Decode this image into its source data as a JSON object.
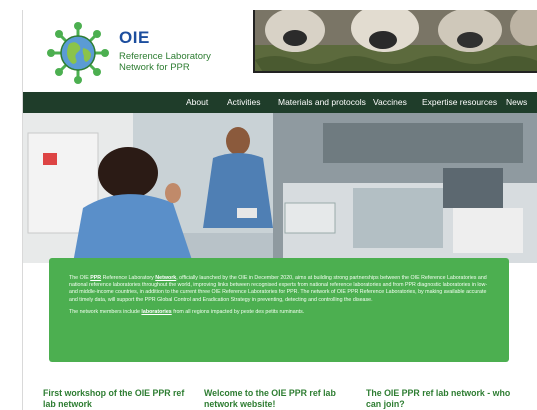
{
  "header": {
    "logo_title": "OIE",
    "logo_subtitle": "Reference Laboratory Network for PPR"
  },
  "nav": {
    "items": [
      {
        "label": "About"
      },
      {
        "label": "Activities"
      },
      {
        "label": "Materials and protocols"
      },
      {
        "label": "Vaccines"
      },
      {
        "label": "Expertise resources"
      },
      {
        "label": "News"
      }
    ]
  },
  "intro": {
    "p1_a": "The OIE ",
    "p1_link1": "PPR",
    "p1_b": " Reference Laboratory ",
    "p1_link2": "Network",
    "p1_c": ", officially launched by the OIE in December 2020, aims at building strong partnerships between the OIE Reference Laboratories and national reference laboratories throughout the world, improving links between recognised experts from national reference laboratories and from PPR diagnostic laboratories in low- and middle-income countries, in addition to the current three OIE Reference Laboratories for PPR. The network of OIE PPR Reference Laboratories, by making available accurate and timely data, will support the PPR Global Control and Eradication Strategy in preventing, detecting and controlling the disease.",
    "p2_a": "The network members include ",
    "p2_link": "laboratories",
    "p2_b": " from all regions impacted by peste des petits ruminants."
  },
  "articles": [
    {
      "title": "First workshop of the OIE PPR ref lab network"
    },
    {
      "title": "Welcome to the OIE PPR ref lab network website!"
    },
    {
      "title": "The OIE PPR ref lab network - who can join?"
    }
  ],
  "colors": {
    "nav_bg": "#1f3d2a",
    "info_box_bg": "#4caf50",
    "title_green": "#2e7d32",
    "logo_blue": "#1d4e9e"
  }
}
